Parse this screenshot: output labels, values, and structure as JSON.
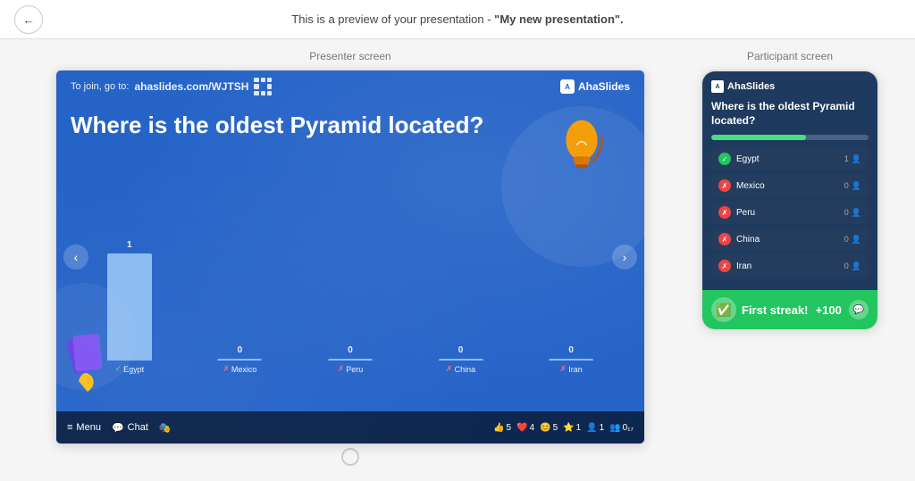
{
  "topbar": {
    "preview_text": "This is a preview of your presentation - ",
    "presentation_name": "\"My new presentation\".",
    "back_label": "←"
  },
  "presenter_section": {
    "label": "Presenter screen",
    "slide": {
      "join_prefix": "To join, go to:",
      "join_url": "ahaslides.com/WJTSH",
      "brand": "AhaSlides",
      "question": "Where is the oldest Pyramid located?",
      "bars": [
        {
          "label": "Egypt",
          "value": "1",
          "correct": true,
          "height": 120
        },
        {
          "label": "Mexico",
          "value": "0",
          "correct": false,
          "height": 0
        },
        {
          "label": "Peru",
          "value": "0",
          "correct": false,
          "height": 0
        },
        {
          "label": "China",
          "value": "0",
          "correct": false,
          "height": 0
        },
        {
          "label": "Iran",
          "value": "0",
          "correct": false,
          "height": 0
        }
      ]
    },
    "toolbar": {
      "menu_label": "Menu",
      "chat_label": "Chat",
      "reactions": [
        {
          "emoji": "👍",
          "count": "5"
        },
        {
          "emoji": "❤️",
          "count": "4"
        },
        {
          "emoji": "😊",
          "count": "5"
        },
        {
          "emoji": "⭐",
          "count": "1"
        },
        {
          "emoji": "👤",
          "count": "1"
        },
        {
          "emoji": "👥",
          "count": "017"
        }
      ]
    }
  },
  "participant_section": {
    "label": "Participant screen",
    "brand": "AhaSlides",
    "question": "Where is the oldest Pyramid located?",
    "progress_pct": 60,
    "answers": [
      {
        "text": "Egypt",
        "count": "1",
        "correct": true
      },
      {
        "text": "Mexico",
        "count": "0",
        "correct": false
      },
      {
        "text": "Peru",
        "count": "0",
        "correct": false
      },
      {
        "text": "China",
        "count": "0",
        "correct": false
      },
      {
        "text": "Iran",
        "count": "0",
        "correct": false
      }
    ],
    "streak": {
      "text": "First streak!",
      "points": "+100"
    }
  }
}
